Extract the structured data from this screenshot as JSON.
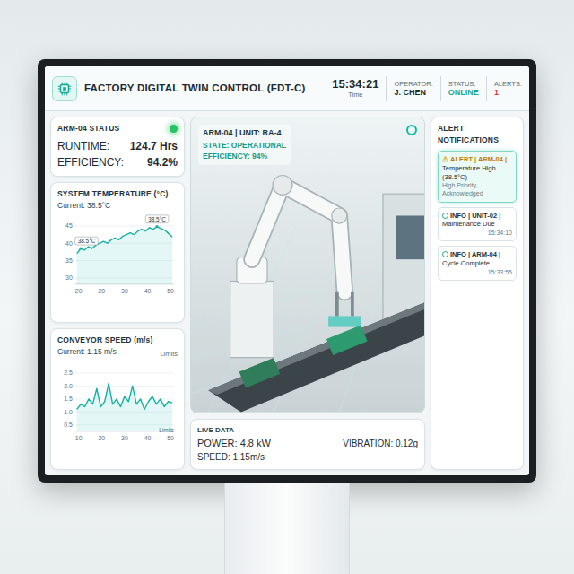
{
  "header": {
    "title": "FACTORY DIGITAL TWIN CONTROL (FDT-C)",
    "time": "15:34:21",
    "time_label": "Time",
    "operator_label": "OPERATOR:",
    "operator": "J. CHEN",
    "status_label": "STATUS:",
    "status": "ONLINE",
    "alerts_label": "ALERTS:",
    "alerts": "1"
  },
  "arm_status": {
    "title": "ARM-04 STATUS",
    "online": true,
    "rows": [
      {
        "label": "RUNTIME:",
        "value": "124.7 Hrs"
      },
      {
        "label": "EFFICIENCY:",
        "value": "94.2%"
      }
    ]
  },
  "temperature_chart": {
    "title": "SYSTEM TEMPERATURE (°C)",
    "current": "Current: 38.5°C",
    "y_ticks": [
      "45",
      "40",
      "35",
      "30"
    ],
    "x_ticks": [
      "20",
      "20",
      "30",
      "40",
      "50"
    ],
    "values": [
      37,
      38.5,
      38,
      39,
      38.5,
      39.5,
      40,
      40.5,
      40,
      41,
      41.5,
      41,
      42,
      42.5,
      43,
      42.5,
      43.5,
      44,
      43.5,
      44.5,
      44,
      44.8,
      44.2,
      43.8,
      42.8,
      41.8
    ],
    "callouts": [
      {
        "text": "38.5°C",
        "index": 1
      },
      {
        "text": "38.5°C",
        "index": 21
      }
    ]
  },
  "speed_chart": {
    "title": "CONVEYOR SPEED (m/s)",
    "current": "Current: 1.15 m/s",
    "limits_labels": [
      "Limits",
      "Limits"
    ],
    "y_ticks": [
      "2.5",
      "2.0",
      "1.5",
      "1.0",
      "0.5"
    ],
    "x_ticks": [
      "10",
      "20",
      "30",
      "40",
      "50"
    ],
    "values": [
      1.1,
      1.3,
      1.2,
      1.5,
      1.3,
      1.9,
      1.2,
      1.4,
      2.1,
      1.3,
      1.5,
      1.2,
      1.6,
      1.4,
      2.0,
      1.3,
      1.5,
      1.1,
      1.4,
      1.6,
      1.3,
      1.5,
      1.2,
      1.4,
      1.35
    ]
  },
  "viewport": {
    "title": "ARM-04 | UNIT: RA-4",
    "state": "STATE: OPERATIONAL",
    "efficiency": "EFFICIENCY: 94%"
  },
  "live_data": {
    "title": "LIVE DATA",
    "items": [
      "POWER: 4.8 kW",
      "VIBRATION: 0.12g",
      "SPEED: 1.15m/s"
    ]
  },
  "alerts_panel": {
    "title": "ALERT NOTIFICATIONS",
    "items": [
      {
        "kind": "alert",
        "icon": "⚠",
        "title": "ALERT | ARM-04 |",
        "detail": "Temperature High (38.5°C)",
        "note": "High Priority, Acknowledged"
      },
      {
        "kind": "info",
        "title": "INFO | UNIT-02 |",
        "detail": "Maintenance Due",
        "time": "15:34:10"
      },
      {
        "kind": "info",
        "title": "INFO | ARM-04 |",
        "detail": "Cycle Complete",
        "time": "15:33:55"
      }
    ]
  }
}
